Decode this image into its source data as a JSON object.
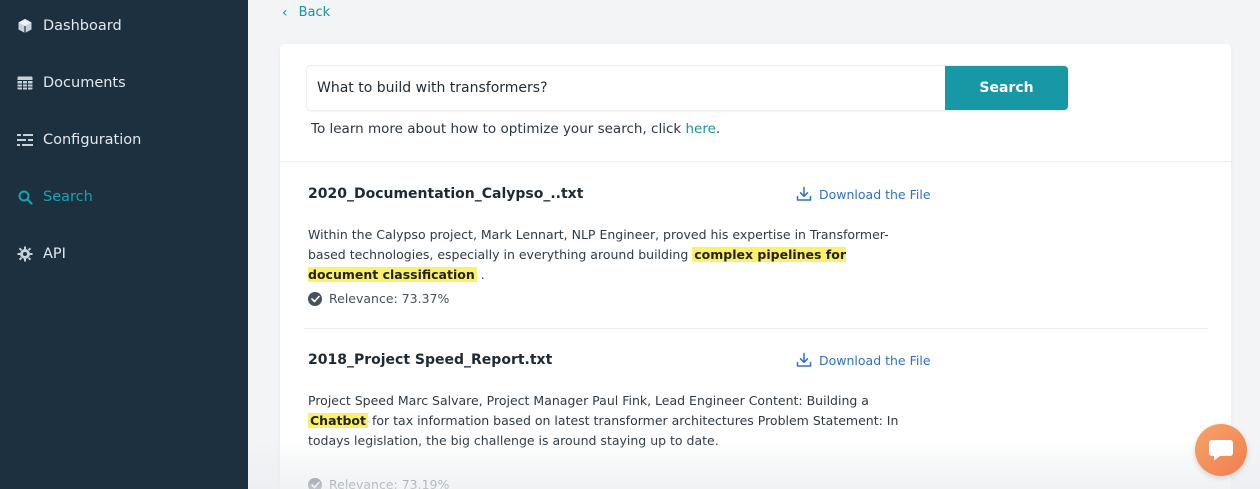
{
  "sidebar": {
    "items": [
      {
        "label": "Dashboard",
        "icon": "cube-icon",
        "active": false
      },
      {
        "label": "Documents",
        "icon": "table-icon",
        "active": false
      },
      {
        "label": "Configuration",
        "icon": "sliders-icon",
        "active": false
      },
      {
        "label": "Search",
        "icon": "search-icon",
        "active": true
      },
      {
        "label": "API",
        "icon": "gear-icon",
        "active": false
      }
    ]
  },
  "main": {
    "back_label": "Back",
    "search": {
      "query": "What to build with transformers?",
      "button_label": "Search"
    },
    "tip": {
      "text": "To learn more about how to optimize your search, click ",
      "link_text": "here",
      "suffix": "."
    },
    "results": [
      {
        "title": "2020_Documentation_Calypso_..txt",
        "download_label": "Download the File",
        "snippet_before": "Within the Calypso project, Mark Lennart, NLP Engineer, proved his expertise in Transformer-based technologies, especially in everything around building ",
        "snippet_highlight": "complex pipelines for document classification",
        "snippet_after": " .",
        "relevance": "Relevance: 73.37%"
      },
      {
        "title": "2018_Project Speed_Report.txt",
        "download_label": "Download the File",
        "snippet_before": "Project Speed Marc Salvare, Project Manager Paul Fink, Lead Engineer Content: Building a ",
        "snippet_highlight": "Chatbot",
        "snippet_after": " for tax information based on latest transformer architectures Problem Statement: In todays legislation, the big challenge is around staying up to date.",
        "relevance": "Relevance: 73.19%"
      }
    ]
  },
  "colors": {
    "sidebar_bg": "#1c3040",
    "accent": "#1898a4",
    "highlight": "#fbf06a",
    "link_blue": "#2f6fcb",
    "chat_orange": "#f07f4f"
  },
  "chat_widget": {
    "icon": "chat-bubble-icon"
  }
}
